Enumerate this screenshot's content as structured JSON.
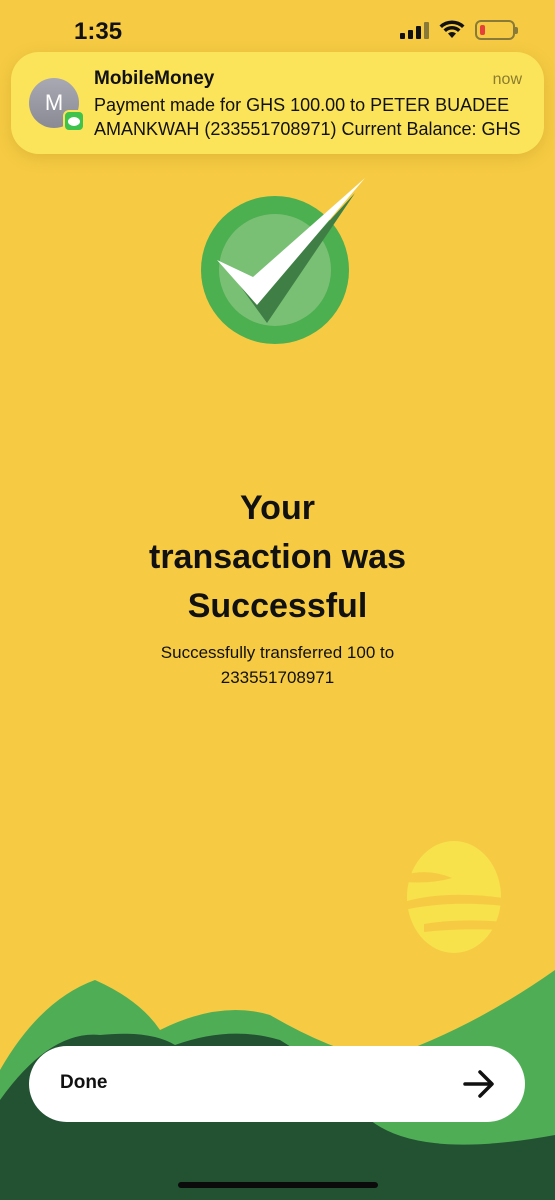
{
  "status_bar": {
    "time": "1:35",
    "battery_level": 0.1,
    "icons": [
      "cellular-signal-icon",
      "wifi-icon",
      "battery-low-icon"
    ]
  },
  "notification": {
    "avatar_initial": "M",
    "app_name": "MobileMoney",
    "time": "now",
    "message": "Payment made for GHS 100.00 to PETER BUADEE AMANKWAH (233551708971) Current Balance: GHS",
    "badge_icon": "messages-icon"
  },
  "success": {
    "icon": "checkmark-icon",
    "title_lines": [
      "Your",
      "transaction was",
      "Successful"
    ],
    "message": "Successfully transferred 100 to 233551708971"
  },
  "done_button": {
    "label": "Done",
    "icon": "arrow-right-icon"
  },
  "colors": {
    "background": "#F6CB43",
    "notification": "#FBE45A",
    "success_green": "#4CAF50",
    "hill_dark": "#235232",
    "hill_light": "#4FAE55",
    "sun": "#F7E24C"
  }
}
